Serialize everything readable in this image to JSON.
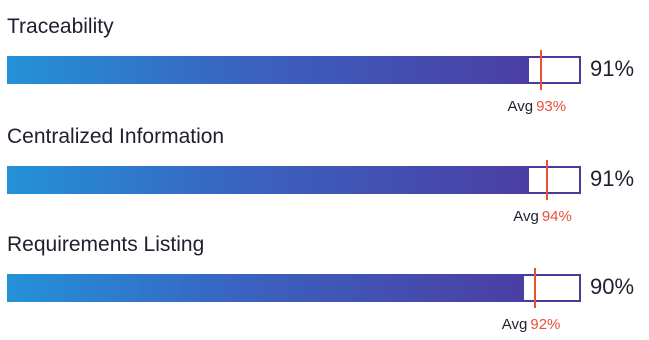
{
  "chart_data": {
    "type": "bar",
    "orientation": "horizontal",
    "categories": [
      "Traceability",
      "Centralized Information",
      "Requirements Listing"
    ],
    "values": [
      91,
      91,
      90
    ],
    "value_labels": [
      "91%",
      "91%",
      "90%"
    ],
    "averages": [
      93,
      94,
      92
    ],
    "average_labels": [
      "93%",
      "94%",
      "92%"
    ],
    "average_word": "Avg",
    "xlim": [
      0,
      100
    ],
    "unit": "%",
    "colors": {
      "bar_start": "#2392d6",
      "bar_end": "#4b3ea4",
      "track_border": "#4a3a9c",
      "average_marker": "#e8503a",
      "text": "#1f1f2e"
    }
  }
}
